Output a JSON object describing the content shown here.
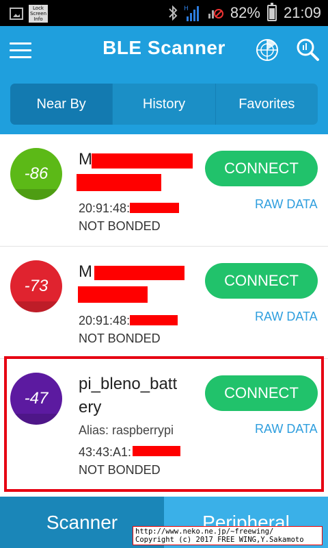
{
  "status_bar": {
    "lock_icon_text": "Lock\nScreen\nInfo",
    "signal_label": "H",
    "battery_percent": "82%",
    "time": "21:09"
  },
  "app_bar": {
    "title": "BLE Scanner",
    "tabs": [
      {
        "label": "Near By",
        "active": true
      },
      {
        "label": "History",
        "active": false
      },
      {
        "label": "Favorites",
        "active": false
      }
    ]
  },
  "devices": [
    {
      "rssi": "-86",
      "rssi_color": "#5cb917",
      "name": "M",
      "address": "20:91:48:",
      "bond_state": "NOT BONDED",
      "connect_label": "CONNECT",
      "raw_label": "RAW DATA"
    },
    {
      "rssi": "-73",
      "rssi_color": "#e0232f",
      "name": "M",
      "address": "20:91:48:",
      "bond_state": "NOT BONDED",
      "connect_label": "CONNECT",
      "raw_label": "RAW DATA"
    },
    {
      "rssi": "-47",
      "rssi_color": "#5c1aa0",
      "name_line1": "pi_bleno_batt",
      "name_line2": "ery",
      "alias": "Alias: raspberrypi",
      "address": "43:43:A1:",
      "bond_state": "NOT BONDED",
      "connect_label": "CONNECT",
      "raw_label": "RAW DATA"
    }
  ],
  "bottom_nav": {
    "scanner": "Scanner",
    "peripheral": "Peripheral"
  },
  "watermark": {
    "line1": "http://www.neko.ne.jp/~freewing/",
    "line2": "Copyright (c) 2017 FREE WING,Y.Sakamoto"
  },
  "colors": {
    "app_bar": "#1f9fdd",
    "connect": "#21c26b",
    "raw_data": "#2e9ede",
    "highlight": "#e60012"
  }
}
